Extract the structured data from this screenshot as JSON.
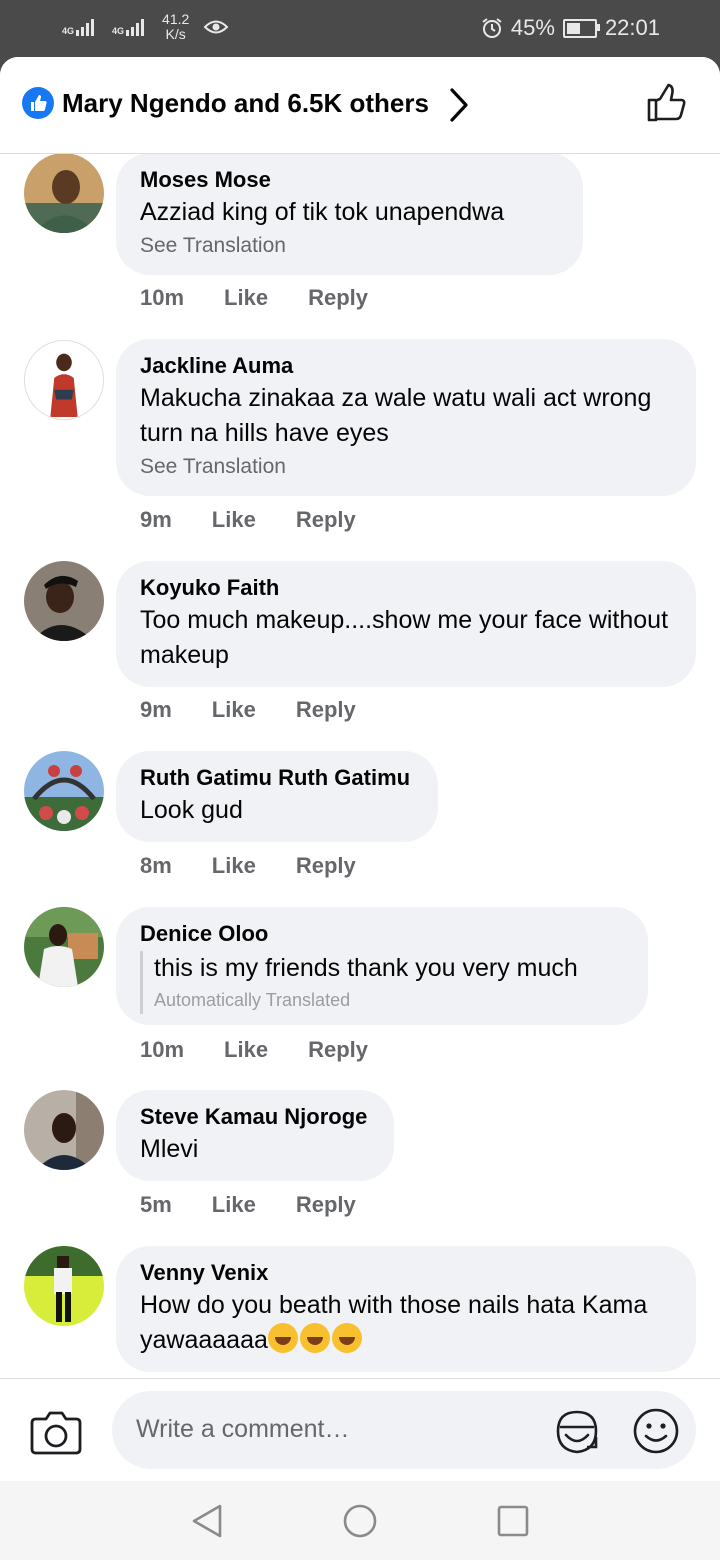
{
  "status_bar": {
    "network1": "4G",
    "network2": "4G",
    "speed_value": "41.2",
    "speed_unit": "K/s",
    "battery": "45%",
    "time": "22:01"
  },
  "header": {
    "title": "Mary Ngendo and 6.5K others"
  },
  "comments": [
    {
      "name": "Moses Mose",
      "text": "Azziad king of tik  tok  unapendwa",
      "sub": "See Translation",
      "time": "10m",
      "like": "Like",
      "reply": "Reply"
    },
    {
      "name": "Jackline Auma",
      "text": "Makucha zinakaa za wale watu wali act wrong turn na hills have eyes",
      "sub": "See Translation",
      "time": "9m",
      "like": "Like",
      "reply": "Reply"
    },
    {
      "name": "Koyuko Faith",
      "text": "Too much makeup....show me your face without makeup",
      "time": "9m",
      "like": "Like",
      "reply": "Reply"
    },
    {
      "name": "Ruth Gatimu Ruth Gatimu",
      "text": "Look gud",
      "time": "8m",
      "like": "Like",
      "reply": "Reply"
    },
    {
      "name": "Denice Oloo",
      "text": "this is my friends thank you very much",
      "sub": "Automatically Translated",
      "time": "10m",
      "like": "Like",
      "reply": "Reply"
    },
    {
      "name": "Steve Kamau Njoroge",
      "text": "Mlevi",
      "time": "5m",
      "like": "Like",
      "reply": "Reply"
    },
    {
      "name": "Venny Venix",
      "text": "How do you beath with those nails hata Kama yawaaaaaa",
      "emoji": "rolling-on-floor-laughing-icon x3",
      "time": "",
      "like": "",
      "reply": ""
    }
  ],
  "composer": {
    "placeholder": "Write a comment…"
  },
  "colors": {
    "accent": "#1877f2",
    "bubble": "#f0f2f5",
    "secondary_text": "#65676b"
  }
}
